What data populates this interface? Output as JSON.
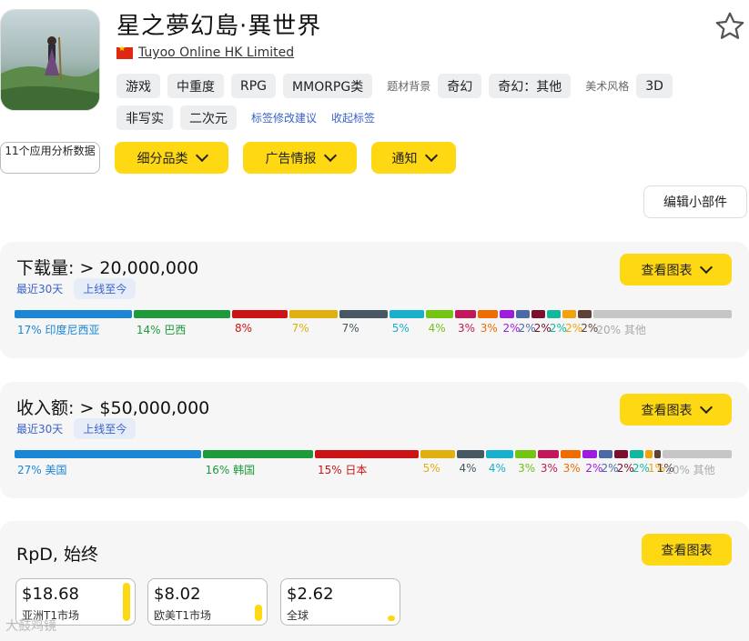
{
  "header": {
    "title": "星之夢幻島·異世界",
    "publisher": "Tuyoo Online HK Limited"
  },
  "tags": {
    "row1": [
      "游戏",
      "中重度",
      "RPG",
      "MMORPG类"
    ],
    "theme_label": "题材背景",
    "theme": [
      "奇幻",
      "奇幻：其他"
    ],
    "art_label": "美术风格",
    "art": [
      "3D",
      "非写实",
      "二次元"
    ],
    "suggest_link": "标签修改建议",
    "collapse_link": "收起标签"
  },
  "actions": {
    "analysis": "11个应用分析数据",
    "subcategory": "细分品类",
    "ad_intel": "广告情报",
    "notify": "通知",
    "edit_widget": "编辑小部件"
  },
  "downloads": {
    "title": "下载量: > 20,000,000",
    "period_active": "最近30天",
    "period_other": "上线至今",
    "chart_button": "查看图表",
    "segments": [
      {
        "pct": 17,
        "label": "17% 印度尼西亚",
        "color": "#1a86d4"
      },
      {
        "pct": 14,
        "label": "14% 巴西",
        "color": "#1e9a3a"
      },
      {
        "pct": 8,
        "label": "8%",
        "color": "#cc1414"
      },
      {
        "pct": 7,
        "label": "7%",
        "color": "#e0b010"
      },
      {
        "pct": 7,
        "label": "7%",
        "color": "#485862"
      },
      {
        "pct": 5,
        "label": "5%",
        "color": "#18b0cc"
      },
      {
        "pct": 4,
        "label": "4%",
        "color": "#74c414"
      },
      {
        "pct": 3,
        "label": "3%",
        "color": "#c2185b"
      },
      {
        "pct": 3,
        "label": "3%",
        "color": "#ef6c00"
      },
      {
        "pct": 2,
        "label": "2%",
        "color": "#9c1ce0"
      },
      {
        "pct": 2,
        "label": "2%",
        "color": "#4a6aa6"
      },
      {
        "pct": 2,
        "label": "2%",
        "color": "#7a0f2e"
      },
      {
        "pct": 2,
        "label": "2%",
        "color": "#12b89e"
      },
      {
        "pct": 2,
        "label": "2%",
        "color": "#f2a20a"
      },
      {
        "pct": 2,
        "label": "2%",
        "color": "#5d4037"
      },
      {
        "pct": 20,
        "label": "20% 其他",
        "color": "#c6c6c6"
      }
    ]
  },
  "revenue": {
    "title": "收入额: > $50,000,000",
    "period_active": "最近30天",
    "period_other": "上线至今",
    "chart_button": "查看图表",
    "segments": [
      {
        "pct": 27,
        "label": "27% 美国",
        "color": "#1a86d4"
      },
      {
        "pct": 16,
        "label": "16% 韩国",
        "color": "#1e9a3a"
      },
      {
        "pct": 15,
        "label": "15% 日本",
        "color": "#cc1414"
      },
      {
        "pct": 5,
        "label": "5%",
        "color": "#e0b010"
      },
      {
        "pct": 4,
        "label": "4%",
        "color": "#485862"
      },
      {
        "pct": 4,
        "label": "4%",
        "color": "#18b0cc"
      },
      {
        "pct": 3,
        "label": "3%",
        "color": "#74c414"
      },
      {
        "pct": 3,
        "label": "3%",
        "color": "#c2185b"
      },
      {
        "pct": 3,
        "label": "3%",
        "color": "#ef6c00"
      },
      {
        "pct": 2,
        "label": "2%",
        "color": "#9c1ce0"
      },
      {
        "pct": 2,
        "label": "2%",
        "color": "#4a6aa6"
      },
      {
        "pct": 2,
        "label": "2%",
        "color": "#7a0f2e"
      },
      {
        "pct": 2,
        "label": "2%",
        "color": "#12b89e"
      },
      {
        "pct": 1,
        "label": "1%",
        "color": "#f2a20a"
      },
      {
        "pct": 1,
        "label": "1%",
        "color": "#5d4037"
      },
      {
        "pct": 10,
        "label": "10% 其他",
        "color": "#c6c6c6"
      }
    ]
  },
  "rpd": {
    "title": "RpD, 始终",
    "chart_button": "查看图表",
    "boxes": [
      {
        "value": "$18.68",
        "label": "亚洲T1市场",
        "level": 1.0
      },
      {
        "value": "$8.02",
        "label": "欧美T1市场",
        "level": 0.43
      },
      {
        "value": "$2.62",
        "label": "全球",
        "level": 0.14
      }
    ]
  },
  "watermark": "大鼓鸡镜"
}
